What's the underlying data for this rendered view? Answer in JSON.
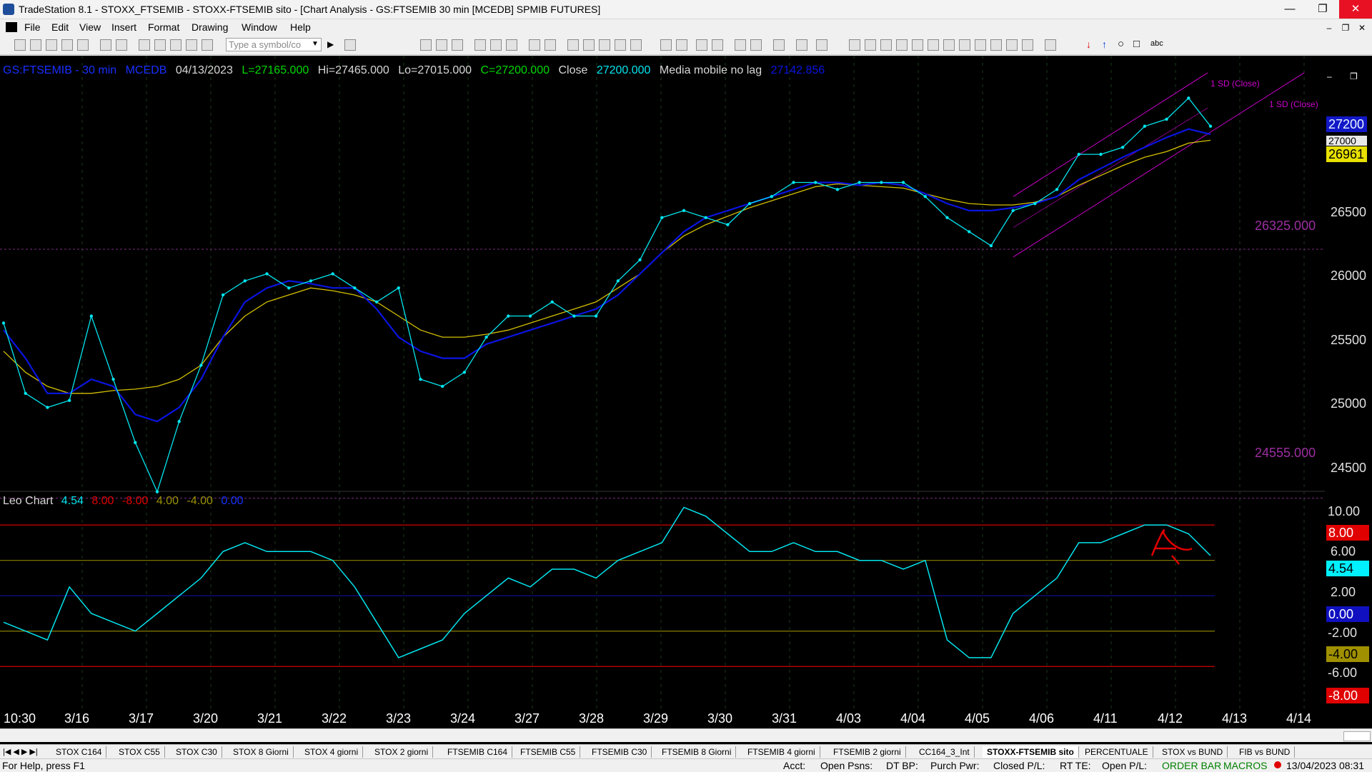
{
  "window": {
    "title": "TradeStation 8.1 - STOXX_FTSEMIB - STOXX-FTSEMIB sito - [Chart Analysis - GS:FTSEMIB  30 min  [MCEDB] SPMIB FUTURES]",
    "controls": {
      "minimize": "—",
      "maximize": "❐",
      "close": "✕"
    }
  },
  "menu": [
    "File",
    "Edit",
    "View",
    "Insert",
    "Format",
    "Drawing",
    "Window",
    "Help"
  ],
  "mdi_controls": {
    "minimize": "–",
    "restore": "❐",
    "close": "✕"
  },
  "toolbar": {
    "symbol_placeholder": "Type a symbol/co",
    "text_tool_label": "abc"
  },
  "chart_header": {
    "symbol": "GS:FTSEMIB - 30 min",
    "exchange": "MCEDB",
    "date": "04/13/2023",
    "last": "L=27165.000",
    "high": "Hi=27465.000",
    "low": "Lo=27015.000",
    "close": "C=27200.000",
    "field": "Close",
    "value": "27200.000",
    "indicator": "Media mobile no lag",
    "indicator_value": "27142.856"
  },
  "indicator_header": {
    "name": "Leo Chart",
    "v1": "4.54",
    "v2": "8.00",
    "v3": "-8.00",
    "v4": "4.00",
    "v5": "-4.00",
    "v6": "0.00"
  },
  "channel_labels": [
    "1 SD (Close)",
    "1 SD (Close)"
  ],
  "levels": {
    "upper": "26325.000",
    "lower": "24555.000"
  },
  "price_axis": {
    "ticks": [
      "26500",
      "26000",
      "25500",
      "25000",
      "24500"
    ],
    "last_price": "27200",
    "avg_price": "26961",
    "hidden_price": "27000"
  },
  "sub_axis": {
    "ticks": [
      "10.00",
      "6.00",
      "2.00",
      "-2.00",
      "-6.00"
    ],
    "boxes": [
      "8.00",
      "4.54",
      "0.00",
      "-4.00",
      "-8.00"
    ]
  },
  "dates": [
    "10:30",
    "3/16",
    "3/17",
    "3/20",
    "3/21",
    "3/22",
    "3/23",
    "3/24",
    "3/27",
    "3/28",
    "3/29",
    "3/30",
    "3/31",
    "4/03",
    "4/04",
    "4/05",
    "4/06",
    "4/11",
    "4/12",
    "4/13",
    "4/14"
  ],
  "tabs": [
    "STOX C164",
    "STOX C55",
    "STOX  C30",
    "STOX  8 Giorni",
    "STOX 4 giorni",
    "STOX  2 giorni",
    "FTSEMIB C164",
    "FTSEMIB C55",
    "FTSEMIB C30",
    "FTSEMIB  8 Giorni",
    "FTSEMIB  4 giorni",
    "FTSEMIB  2 giorni",
    "CC164_3_Int",
    "STOXX-FTSEMIB sito",
    "PERCENTUALE",
    "STOX vs BUND",
    "FIB vs BUND"
  ],
  "active_tab": "STOXX-FTSEMIB sito",
  "status": {
    "help": "For Help, press F1",
    "acct": "Acct:",
    "open_psns": "Open Psns:",
    "dt_bp": "DT BP:",
    "purch_pwr": "Purch Pwr:",
    "closed_pl": "Closed P/L:",
    "rt_te": "RT TE:",
    "open_pl": "Open P/L:",
    "order_bar": "ORDER BAR",
    "macros": "MACROS",
    "datetime": "13/04/2023 08:31"
  },
  "colors": {
    "price_line": "#00e5ee",
    "avg_fast": "#0a14e0",
    "avg_slow": "#d4c000",
    "channel": "#cc00cc",
    "level": "#7a2a80",
    "band_red": "#d00000",
    "band_olive": "#8a8000",
    "band_blue": "#1010a0"
  },
  "chart_data": {
    "type": "line",
    "x": [
      "3/15 10:30",
      "3/16",
      "3/16",
      "3/16",
      "3/17",
      "3/17",
      "3/17",
      "3/20",
      "3/20",
      "3/20",
      "3/21",
      "3/21",
      "3/21",
      "3/22",
      "3/22",
      "3/22",
      "3/23",
      "3/23",
      "3/23",
      "3/24",
      "3/24",
      "3/24",
      "3/27",
      "3/27",
      "3/27",
      "3/28",
      "3/28",
      "3/28",
      "3/29",
      "3/29",
      "3/29",
      "3/30",
      "3/30",
      "3/30",
      "3/31",
      "3/31",
      "3/31",
      "4/03",
      "4/03",
      "4/03",
      "4/04",
      "4/04",
      "4/04",
      "4/05",
      "4/05",
      "4/05",
      "4/06",
      "4/06",
      "4/06",
      "4/11",
      "4/11",
      "4/11",
      "4/12",
      "4/12",
      "4/12",
      "4/13"
    ],
    "series": [
      {
        "values": [
          25800,
          25300,
          25200,
          25250,
          25850,
          25400,
          24950,
          24600,
          25100,
          25500,
          26000,
          26100,
          26150,
          26050,
          26100,
          26150,
          26050,
          25950,
          26050,
          25400,
          25350,
          25450,
          25700,
          25850,
          25850,
          25950,
          25850,
          25850,
          26100,
          26250,
          26550,
          26600,
          26550,
          26500,
          26650,
          26700,
          26800,
          26800,
          26750,
          26800,
          26800,
          26800,
          26700,
          26550,
          26450,
          26350,
          26600,
          26650,
          26750,
          27000,
          27000,
          27050,
          27200,
          27250,
          27400,
          27200
        ]
      },
      {
        "values": [
          25750,
          25550,
          25300,
          25300,
          25400,
          25350,
          25150,
          25100,
          25200,
          25400,
          25700,
          25950,
          26050,
          26100,
          26080,
          26050,
          26050,
          25900,
          25700,
          25600,
          25550,
          25550,
          25650,
          25700,
          25750,
          25800,
          25850,
          25900,
          26000,
          26150,
          26300,
          26450,
          26550,
          26600,
          26650,
          26700,
          26750,
          26800,
          26800,
          26780,
          26800,
          26780,
          26720,
          26650,
          26600,
          26600,
          26620,
          26650,
          26700,
          26820,
          26900,
          26980,
          27050,
          27120,
          27180,
          27143
        ]
      },
      {
        "values": [
          25600,
          25450,
          25350,
          25300,
          25300,
          25320,
          25330,
          25350,
          25400,
          25500,
          25700,
          25850,
          25950,
          26000,
          26050,
          26030,
          26000,
          25950,
          25850,
          25750,
          25700,
          25700,
          25720,
          25750,
          25800,
          25850,
          25900,
          25950,
          26050,
          26150,
          26300,
          26420,
          26500,
          26560,
          26620,
          26670,
          26720,
          26770,
          26790,
          26780,
          26770,
          26760,
          26720,
          26680,
          26650,
          26640,
          26640,
          26660,
          26700,
          26780,
          26850,
          26920,
          26980,
          27020,
          27080,
          27100
        ]
      },
      {
        "values": [
          -3,
          -4,
          -5,
          1,
          -2,
          -3,
          -4,
          -2,
          0,
          2,
          5,
          6,
          5,
          5,
          5,
          4,
          1,
          -3,
          -7,
          -6,
          -5,
          -2,
          0,
          2,
          1,
          3,
          3,
          2,
          4,
          5,
          6,
          10,
          9,
          7,
          5,
          5,
          6,
          5,
          5,
          4,
          4,
          3,
          4,
          -5,
          -7,
          -7,
          -2,
          0,
          2,
          6,
          6,
          7,
          8,
          8,
          7,
          4.54
        ]
      }
    ],
    "ylim": [
      24400,
      27600
    ]
  }
}
